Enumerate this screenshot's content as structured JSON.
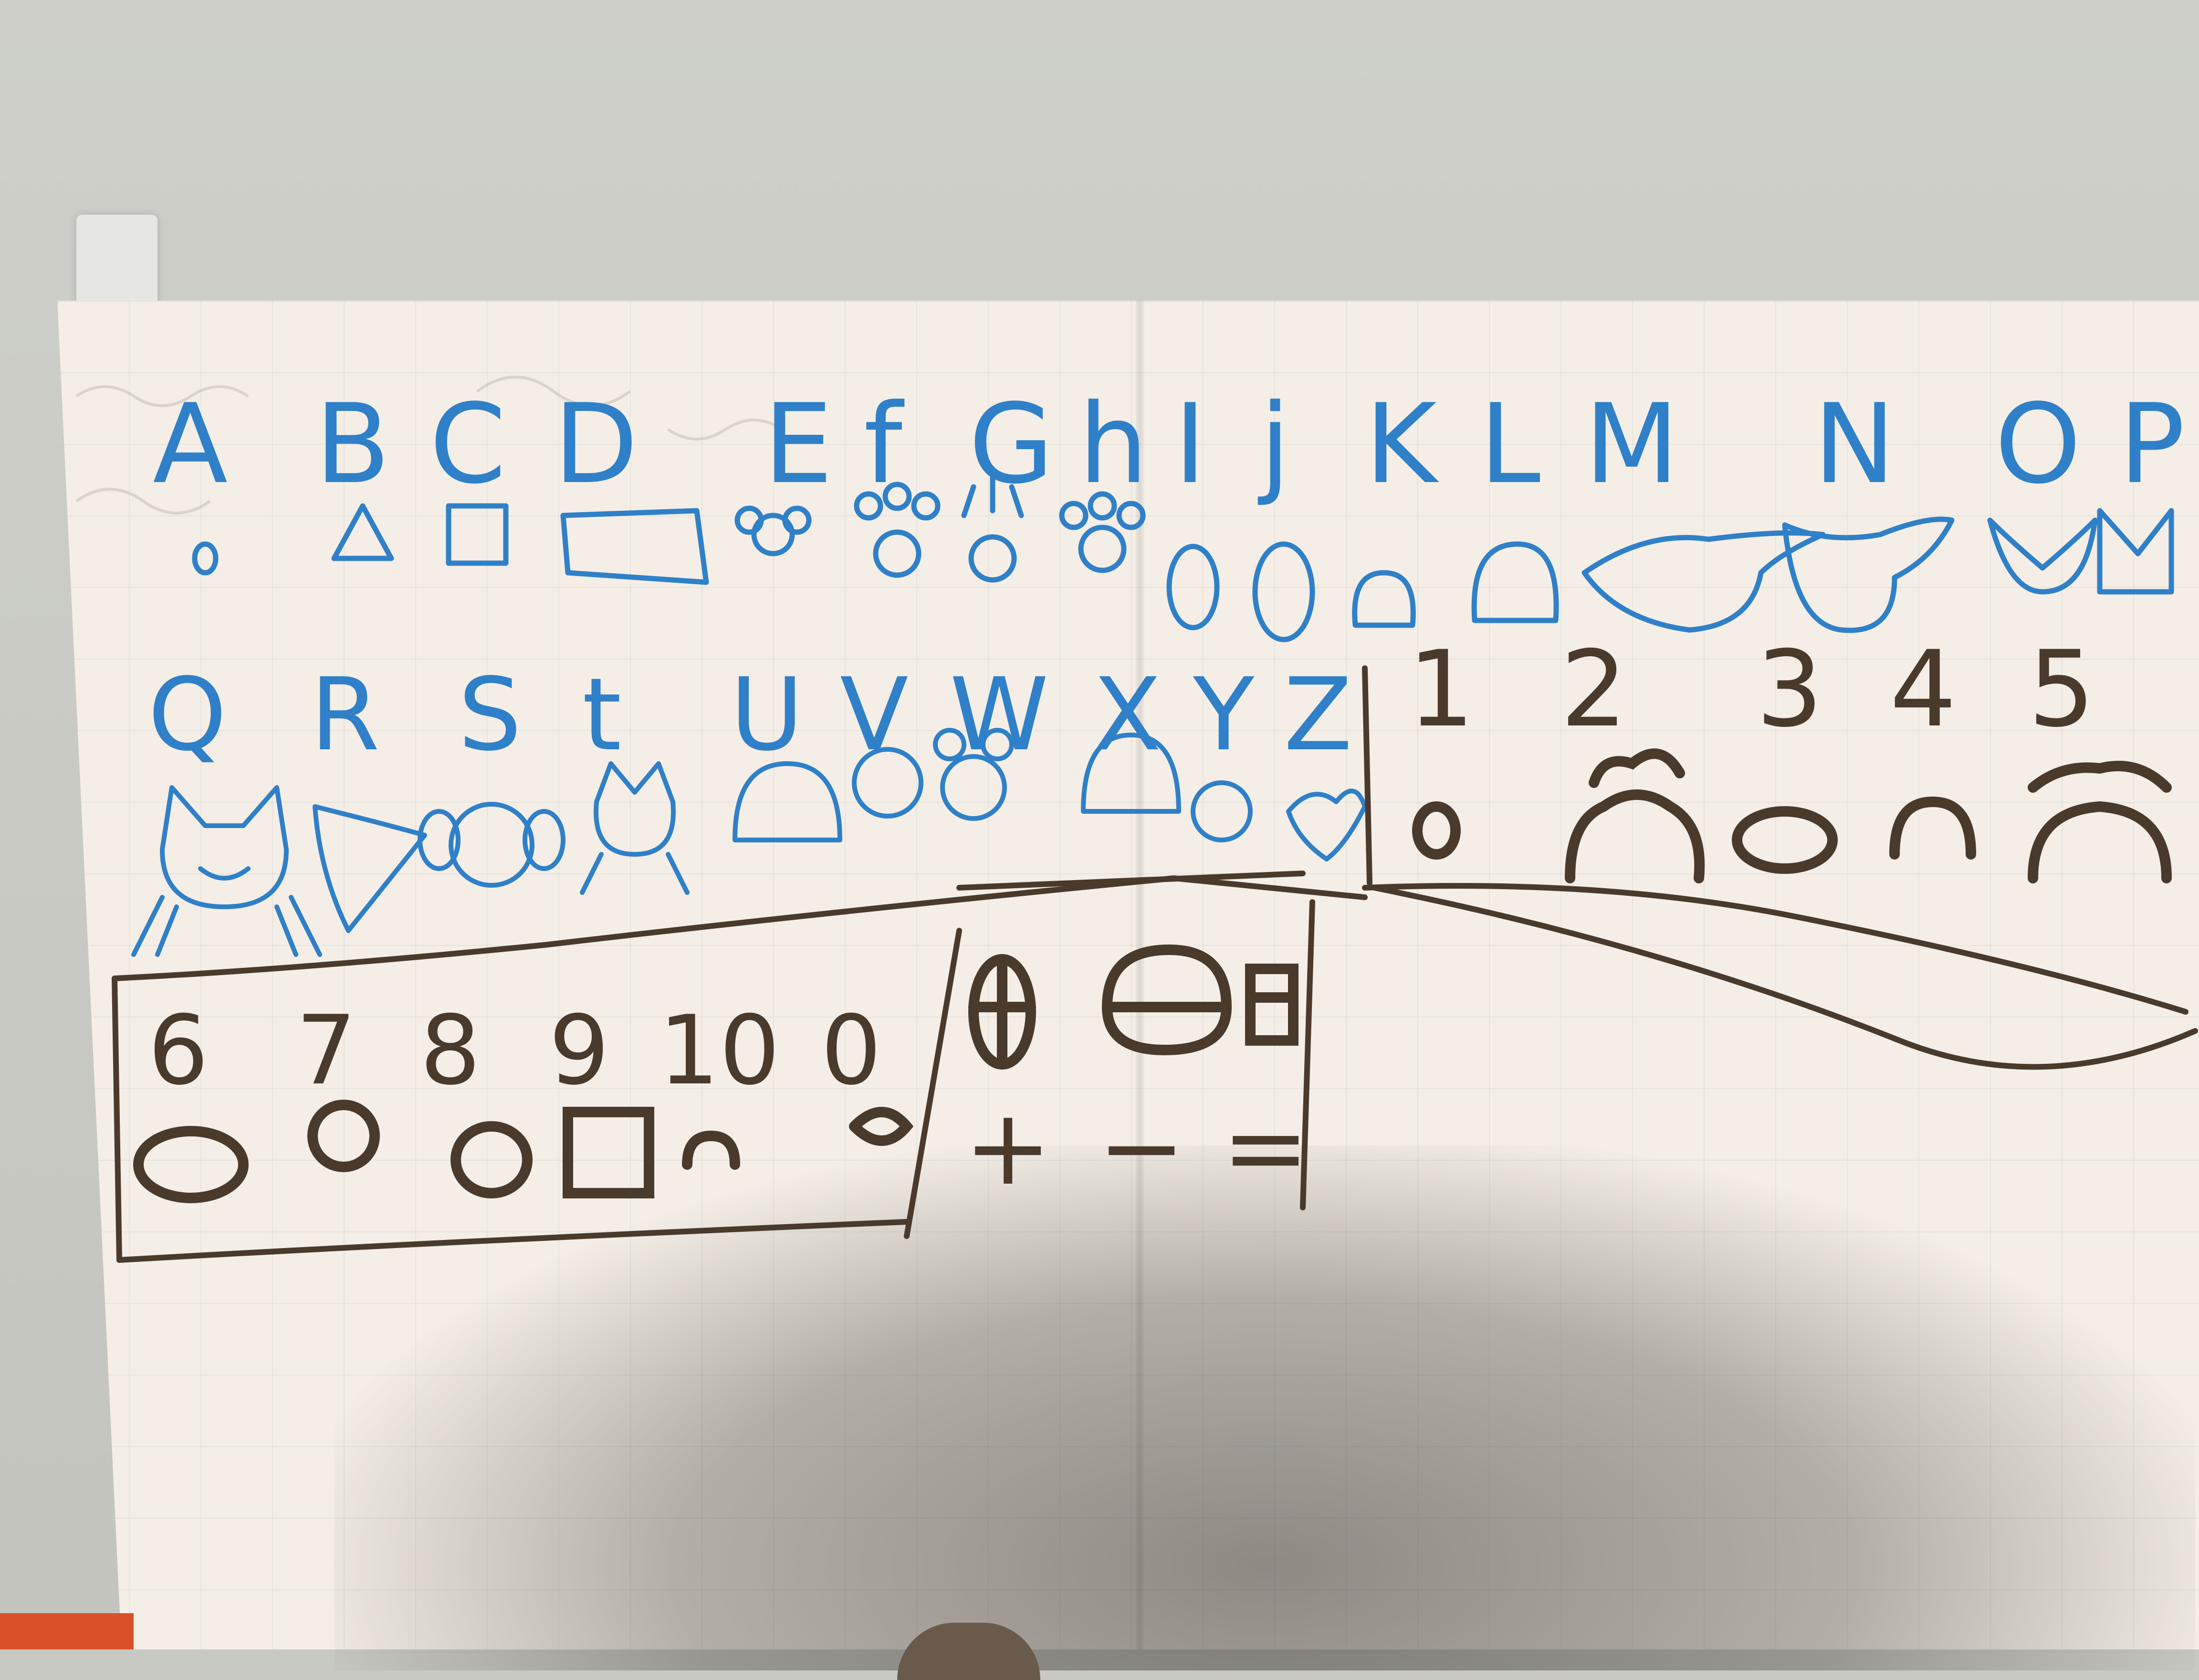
{
  "photo": {
    "subject": "handwritten alphabet and number chart on grid paper"
  },
  "alphabet_row_1": [
    "A",
    "B",
    "C",
    "D",
    "E",
    "f",
    "G",
    "h",
    "I",
    "j",
    "K",
    "L",
    "M",
    "N",
    "O",
    "P"
  ],
  "alphabet_row_2": [
    "Q",
    "R",
    "S",
    "t",
    "U",
    "V",
    "W",
    "X",
    "Y",
    "Z"
  ],
  "numbers_row_1": [
    "1",
    "2",
    "3",
    "4",
    "5"
  ],
  "numbers_row_2": [
    "6",
    "7",
    "8",
    "9",
    "10",
    "0"
  ],
  "operators": [
    "+",
    "−",
    "="
  ],
  "colors": {
    "blue_ink": "#2f80c8",
    "brown_ink": "#4a3a2c",
    "paper": "#f4eee6",
    "wall": "#cacbc5"
  }
}
